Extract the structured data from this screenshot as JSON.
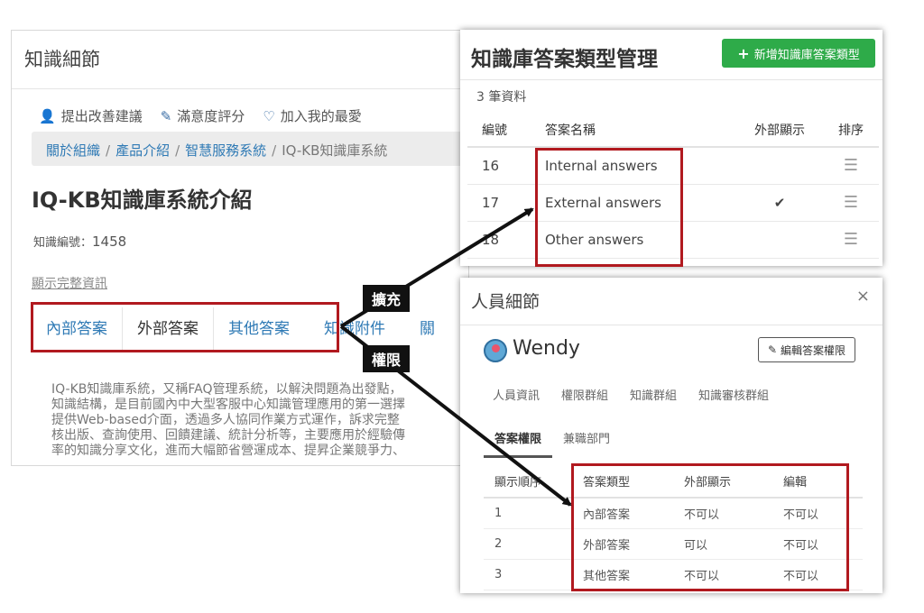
{
  "knowledge_panel": {
    "title": "知識細節",
    "actions": [
      {
        "icon": "user-edit-icon",
        "label": "提出改善建議"
      },
      {
        "icon": "pencil-icon",
        "label": "滿意度評分"
      },
      {
        "icon": "heart-icon",
        "label": "加入我的最愛"
      }
    ],
    "breadcrumb": [
      "關於組織",
      "產品介紹",
      "智慧服務系統",
      "IQ-KB知識庫系統"
    ],
    "doc_title": "IQ-KB知識庫系統介紹",
    "doc_number_label": "知識編號：",
    "doc_number": "1458",
    "show_full": "顯示完整資訊",
    "tabs": [
      "內部答案",
      "外部答案",
      "其他答案",
      "知識附件",
      "關"
    ],
    "active_tab": "外部答案",
    "description_lines": [
      "IQ-KB知識庫系統，又稱FAQ管理系統，以解決問題為出發點，",
      "知識結構，是目前國內中大型客服中心知識管理應用的第一選擇",
      "提供Web-based介面，透過多人協同作業方式運作，訴求完整",
      "核出版、查詢使用、回饋建議、統計分析等，主要應用於經驗傳",
      "率的知識分享文化，進而大幅節省營運成本、提昇企業競爭力、"
    ]
  },
  "answer_type_panel": {
    "title": "知識庫答案類型管理",
    "add_button": "新增知識庫答案類型",
    "count": "3 筆資料",
    "columns": [
      "編號",
      "答案名稱",
      "外部顯示",
      "排序"
    ],
    "rows": [
      {
        "id": "16",
        "name": "Internal answers",
        "external": ""
      },
      {
        "id": "17",
        "name": "External answers",
        "external": "✔"
      },
      {
        "id": "18",
        "name": "Other answers",
        "external": ""
      }
    ],
    "sort_glyph": "☰"
  },
  "labels": {
    "extend": "擴充",
    "permission": "權限"
  },
  "person_panel": {
    "title": "人員細節",
    "close": "×",
    "name": "Wendy",
    "edit_button": "編輯答案權限",
    "tabs_row1": [
      "人員資訊",
      "權限群組",
      "知識群組",
      "知識審核群組"
    ],
    "tabs_row2": [
      "答案權限",
      "兼職部門"
    ],
    "active_tab": "答案權限",
    "columns": [
      "顯示順序",
      "答案類型",
      "外部顯示",
      "編輯"
    ],
    "rows": [
      {
        "order": "1",
        "type": "內部答案",
        "external": "不可以",
        "edit": "不可以"
      },
      {
        "order": "2",
        "type": "外部答案",
        "external": "可以",
        "edit": "不可以"
      },
      {
        "order": "3",
        "type": "其他答案",
        "external": "不可以",
        "edit": "不可以"
      }
    ]
  },
  "colors": {
    "highlight_box": "#b1191f",
    "link": "#2f7ab5",
    "add_button": "#2eab49",
    "label_bg": "#111111"
  }
}
